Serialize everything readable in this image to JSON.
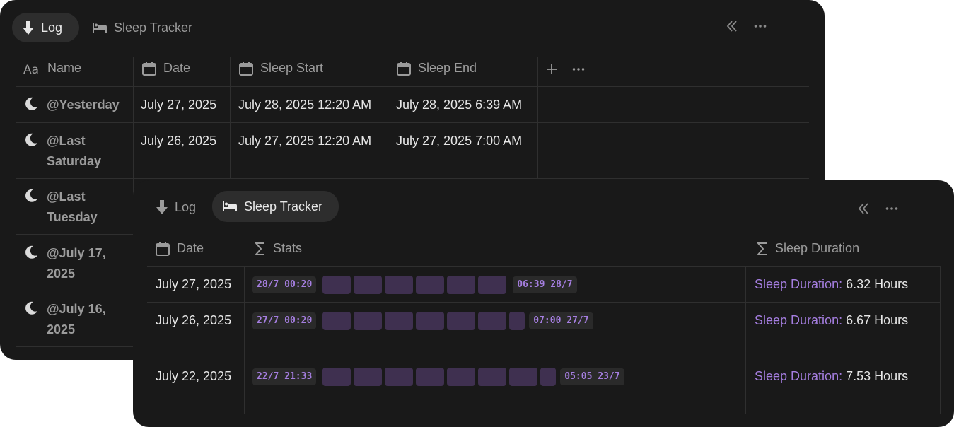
{
  "back_panel": {
    "tabs": [
      {
        "label": "Log",
        "icon": "arrow-down-icon",
        "active": true
      },
      {
        "label": "Sleep Tracker",
        "icon": "bed-icon",
        "active": false
      }
    ],
    "columns": [
      {
        "label": "Name",
        "icon": "text-type-icon"
      },
      {
        "label": "Date",
        "icon": "calendar-icon"
      },
      {
        "label": "Sleep Start",
        "icon": "calendar-icon"
      },
      {
        "label": "Sleep End",
        "icon": "calendar-icon"
      }
    ],
    "rows": [
      {
        "name": [
          "@Yesterday"
        ],
        "date": "July 27, 2025",
        "start": "July 28, 2025 12:20 AM",
        "end": "July 28, 2025 6:39 AM"
      },
      {
        "name": [
          "@Last",
          "Saturday"
        ],
        "date": "July 26, 2025",
        "start": "July 27, 2025 12:20 AM",
        "end": "July 27, 2025 7:00 AM"
      },
      {
        "name": [
          "@Last",
          "Tuesday"
        ]
      },
      {
        "name": [
          "@July 17,",
          "2025"
        ]
      },
      {
        "name": [
          "@July 16,",
          "2025"
        ]
      }
    ]
  },
  "front_panel": {
    "tabs": [
      {
        "label": "Log",
        "icon": "arrow-down-icon",
        "active": false
      },
      {
        "label": "Sleep Tracker",
        "icon": "bed-icon",
        "active": true
      }
    ],
    "columns": [
      {
        "label": "Date",
        "icon": "calendar-icon"
      },
      {
        "label": "Stats",
        "icon": "sigma-icon"
      },
      {
        "label": "Sleep Duration",
        "icon": "sigma-icon"
      }
    ],
    "rows": [
      {
        "date": "July 27, 2025",
        "start_pill": "28/7 00:20",
        "end_pill": "06:39 28/7",
        "blocks": 6,
        "partial": false,
        "duration_label": "Sleep Duration:",
        "duration_value": "6.32 Hours"
      },
      {
        "date": "July 26, 2025",
        "start_pill": "27/7 00:20",
        "end_pill": "07:00 27/7",
        "blocks": 6,
        "partial": true,
        "duration_label": "Sleep Duration:",
        "duration_value": "6.67 Hours"
      },
      {
        "date": "July 22, 2025",
        "start_pill": "22/7 21:33",
        "end_pill": "05:05 23/7",
        "blocks": 7,
        "partial": true,
        "duration_label": "Sleep Duration:",
        "duration_value": "7.53 Hours"
      }
    ]
  },
  "colors": {
    "background": "#191919",
    "accent": "#a57ee0",
    "block": "#3f3050"
  }
}
